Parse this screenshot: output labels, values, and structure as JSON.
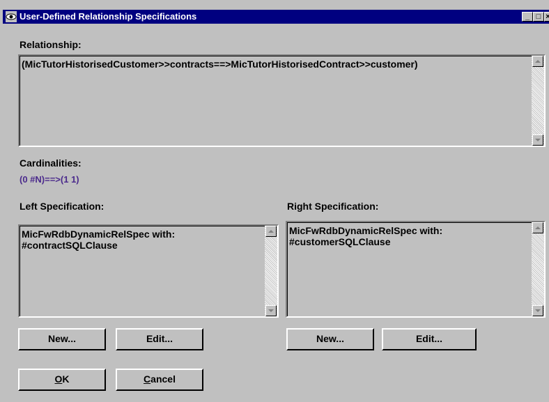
{
  "window": {
    "title": "User-Defined Relationship Specifications",
    "controls": {
      "minimize": "_",
      "maximize": "□",
      "close": "×"
    }
  },
  "relationship": {
    "label": "Relationship:",
    "value": "(MicTutorHistorisedCustomer>>contracts==>MicTutorHistorisedContract>>customer)"
  },
  "cardinalities": {
    "label": "Cardinalities:",
    "value": "(0 #N)==>(1 1)",
    "value_color": "#4b2a8c"
  },
  "left_spec": {
    "label": "Left Specification:",
    "text": "MicFwRdbDynamicRelSpec with:\n#contractSQLClause",
    "new_button": "New...",
    "edit_button": "Edit..."
  },
  "right_spec": {
    "label": "Right Specification:",
    "text": "MicFwRdbDynamicRelSpec with:\n#customerSQLClause",
    "new_button": "New...",
    "edit_button": "Edit..."
  },
  "buttons": {
    "ok_mnemonic": "O",
    "ok_rest": "K",
    "cancel_mnemonic": "C",
    "cancel_rest": "ancel"
  },
  "colors": {
    "titlebar": "#000080",
    "face": "#c0c0c0"
  }
}
